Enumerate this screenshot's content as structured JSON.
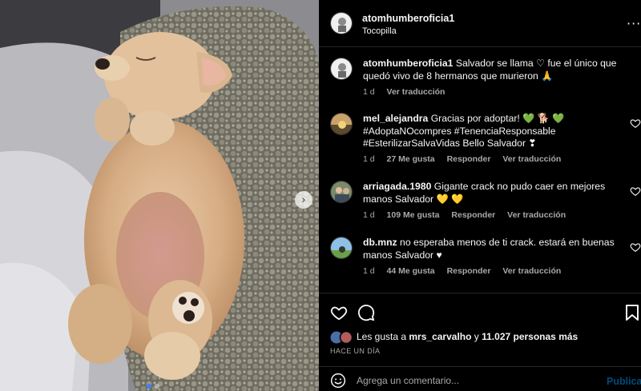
{
  "post": {
    "author": "atomhumberoficia1",
    "location": "Tocopilla",
    "more_icon": "more-horizontal-icon"
  },
  "caption": {
    "username": "atomhumberoficia1",
    "text": "Salvador se llama ♡ fue el único que quedó vivo de 8 hermanos que murieron 🙏",
    "time": "1 d",
    "translate": "Ver traducción"
  },
  "comments": [
    {
      "username": "mel_alejandra",
      "text": "Gracias por adoptar! 💚 🐕 💚 #AdoptaNOcompres #TenenciaResponsable #EsterilizarSalvaVidas Bello Salvador ❣",
      "time": "1 d",
      "likes": "27 Me gusta",
      "reply": "Responder",
      "translate": "Ver traducción"
    },
    {
      "username": "arriagada.1980",
      "text": "Gigante crack no pudo caer en mejores manos Salvador 💛 💛",
      "time": "1 d",
      "likes": "109 Me gusta",
      "reply": "Responder",
      "translate": "Ver traducción"
    },
    {
      "username": "db.mnz",
      "text": "no esperaba menos de ti crack. estará en buenas manos Salvador ♥",
      "time": "1 d",
      "likes": "44 Me gusta",
      "reply": "Responder",
      "translate": "Ver traducción"
    }
  ],
  "likes": {
    "prefix": "Les gusta a",
    "user": "mrs_carvalho",
    "connector": "y",
    "others": "11.027 personas más"
  },
  "posted": "HACE UN DÍA",
  "composer": {
    "placeholder": "Agrega un comentario...",
    "publish": "Publicar"
  },
  "carousel": {
    "current": 1,
    "total": 2
  },
  "colors": {
    "background": "#000000",
    "text": "#f5f5f5",
    "muted": "#a8a8a8",
    "link": "#0095f6"
  }
}
